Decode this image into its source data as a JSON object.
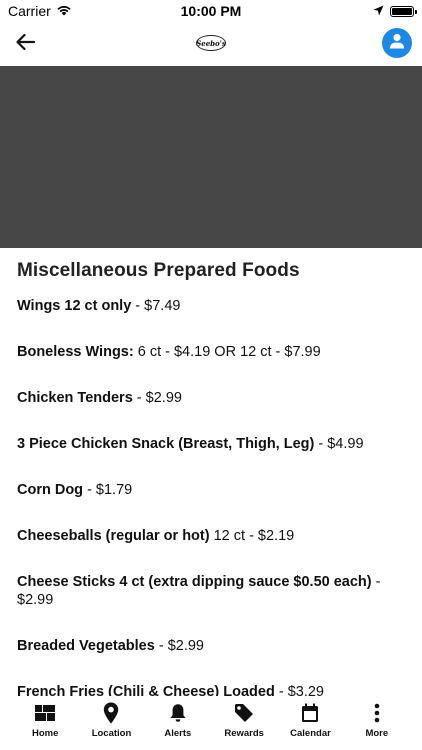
{
  "status_bar": {
    "carrier": "Carrier",
    "time": "10:00 PM"
  },
  "nav": {
    "logo_text": "Seebo's"
  },
  "page": {
    "title": "Miscellaneous Prepared Foods"
  },
  "menu_items": [
    {
      "name": "Wings 12 ct only",
      "detail": " - $7.49"
    },
    {
      "name": "Boneless Wings:",
      "detail": " 6 ct - $4.19 OR 12 ct - $7.99"
    },
    {
      "name": "Chicken Tenders",
      "detail": " - $2.99"
    },
    {
      "name": "3 Piece Chicken Snack (Breast, Thigh, Leg)",
      "detail": " - $4.99"
    },
    {
      "name": "Corn Dog",
      "detail": " - $1.79"
    },
    {
      "name": "Cheeseballs (regular or hot)",
      "detail": " 12 ct - $2.19"
    },
    {
      "name": "Cheese Sticks 4 ct (extra dipping sauce $0.50 each)",
      "detail": " - $2.99"
    },
    {
      "name": "Breaded Vegetables",
      "detail": " - $2.99"
    },
    {
      "name": "French Fries (Chili & Cheese) Loaded",
      "detail": " - $3.29"
    }
  ],
  "tabs": [
    {
      "label": "Home",
      "icon": "grid-icon"
    },
    {
      "label": "Location",
      "icon": "map-pin-icon"
    },
    {
      "label": "Alerts",
      "icon": "bell-icon"
    },
    {
      "label": "Rewards",
      "icon": "tag-icon"
    },
    {
      "label": "Calendar",
      "icon": "calendar-icon"
    },
    {
      "label": "More",
      "icon": "more-vertical-icon"
    }
  ],
  "colors": {
    "accent": "#1e88e5",
    "hero_placeholder": "#474747"
  }
}
